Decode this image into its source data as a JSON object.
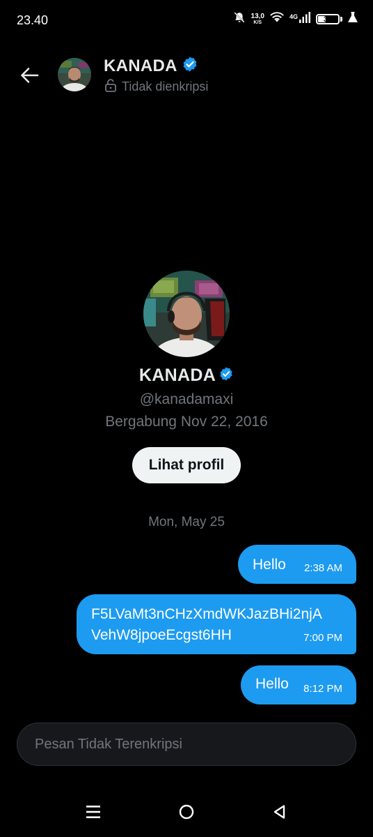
{
  "status_bar": {
    "time": "23.40",
    "net_speed_value": "13,0",
    "net_speed_unit": "K/S",
    "network_type": "4G",
    "battery_level": "36",
    "icons": [
      "bell-off-icon",
      "wifi-icon",
      "signal-icon",
      "battery-icon",
      "lab-flask-icon"
    ]
  },
  "header": {
    "name": "KANADA",
    "encryption_status": "Tidak dienkripsi",
    "verified": true
  },
  "profile": {
    "name": "KANADA",
    "handle": "@kanadamaxi",
    "joined": "Bergabung Nov 22, 2016",
    "view_profile_label": "Lihat profil"
  },
  "conversation": {
    "date_separator": "Mon, May 25",
    "messages": [
      {
        "text": "Hello",
        "time": "2:38 AM",
        "sent": true
      },
      {
        "line1": "F5LVaMt3nCHzXmdWKJazBHi2njA",
        "line2": "VehW8jpoeEcgst6HH",
        "time": "7:00 PM",
        "sent": true
      },
      {
        "text": "Hello",
        "time": "8:12 PM",
        "sent": true
      }
    ]
  },
  "composer": {
    "placeholder": "Pesan Tidak Terenkripsi",
    "value": ""
  },
  "colors": {
    "background": "#000000",
    "accent": "#1d9bf0",
    "muted_text": "#71767b",
    "primary_text": "#e7e9ea",
    "button_bg": "#eff3f4"
  }
}
